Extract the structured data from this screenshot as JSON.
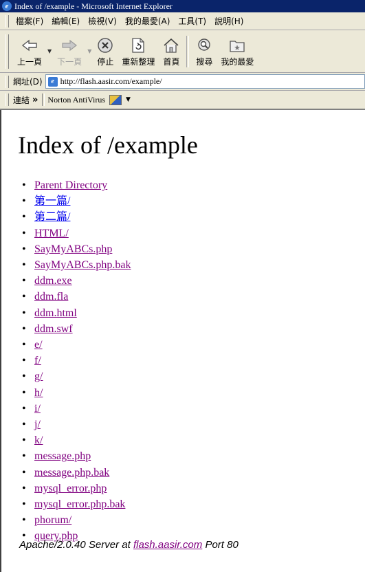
{
  "window": {
    "title": "Index of /example - Microsoft Internet Explorer"
  },
  "menu": [
    {
      "label": "檔案(F)"
    },
    {
      "label": "編輯(E)"
    },
    {
      "label": "檢視(V)"
    },
    {
      "label": "我的最愛(A)"
    },
    {
      "label": "工具(T)"
    },
    {
      "label": "說明(H)"
    }
  ],
  "toolbar": {
    "back": {
      "label": "上一頁",
      "icon": "back-arrow-icon"
    },
    "forward": {
      "label": "下一頁",
      "icon": "forward-arrow-icon"
    },
    "stop": {
      "label": "停止",
      "icon": "stop-icon"
    },
    "refresh": {
      "label": "重新整理",
      "icon": "refresh-icon"
    },
    "home": {
      "label": "首頁",
      "icon": "home-icon"
    },
    "search": {
      "label": "搜尋",
      "icon": "search-icon"
    },
    "favorites": {
      "label": "我的最愛",
      "icon": "favorites-icon"
    }
  },
  "address": {
    "label": "網址(D)",
    "url": "http://flash.aasir.com/example/"
  },
  "links": {
    "label": "連結",
    "chevron": "»",
    "item": "Norton AntiVirus"
  },
  "page": {
    "heading": "Index of /example",
    "entries": [
      {
        "name": "Parent Directory",
        "state": "visited"
      },
      {
        "name": "第一篇/",
        "state": "fresh"
      },
      {
        "name": "第二篇/",
        "state": "fresh"
      },
      {
        "name": "HTML/",
        "state": "visited"
      },
      {
        "name": "SayMyABCs.php",
        "state": "visited"
      },
      {
        "name": "SayMyABCs.php.bak",
        "state": "visited"
      },
      {
        "name": "ddm.exe",
        "state": "visited"
      },
      {
        "name": "ddm.fla",
        "state": "visited"
      },
      {
        "name": "ddm.html",
        "state": "visited"
      },
      {
        "name": "ddm.swf",
        "state": "visited"
      },
      {
        "name": "e/",
        "state": "visited"
      },
      {
        "name": "f/",
        "state": "visited"
      },
      {
        "name": "g/",
        "state": "visited"
      },
      {
        "name": "h/",
        "state": "visited"
      },
      {
        "name": "i/",
        "state": "visited"
      },
      {
        "name": "j/",
        "state": "visited"
      },
      {
        "name": "k/",
        "state": "visited"
      },
      {
        "name": "message.php",
        "state": "visited"
      },
      {
        "name": "message.php.bak",
        "state": "visited"
      },
      {
        "name": "mysql_error.php",
        "state": "visited"
      },
      {
        "name": "mysql_error.php.bak",
        "state": "visited"
      },
      {
        "name": "phorum/",
        "state": "visited"
      },
      {
        "name": "query.php",
        "state": "visited"
      }
    ],
    "footer": {
      "prefix": "Apache/2.0.40 Server at",
      "host": "flash.aasir.com",
      "suffix": "Port 80"
    }
  },
  "colors": {
    "titlebar": "#0a246a",
    "chrome": "#ece9d8",
    "link": "#0000ee",
    "visited": "#800080"
  }
}
